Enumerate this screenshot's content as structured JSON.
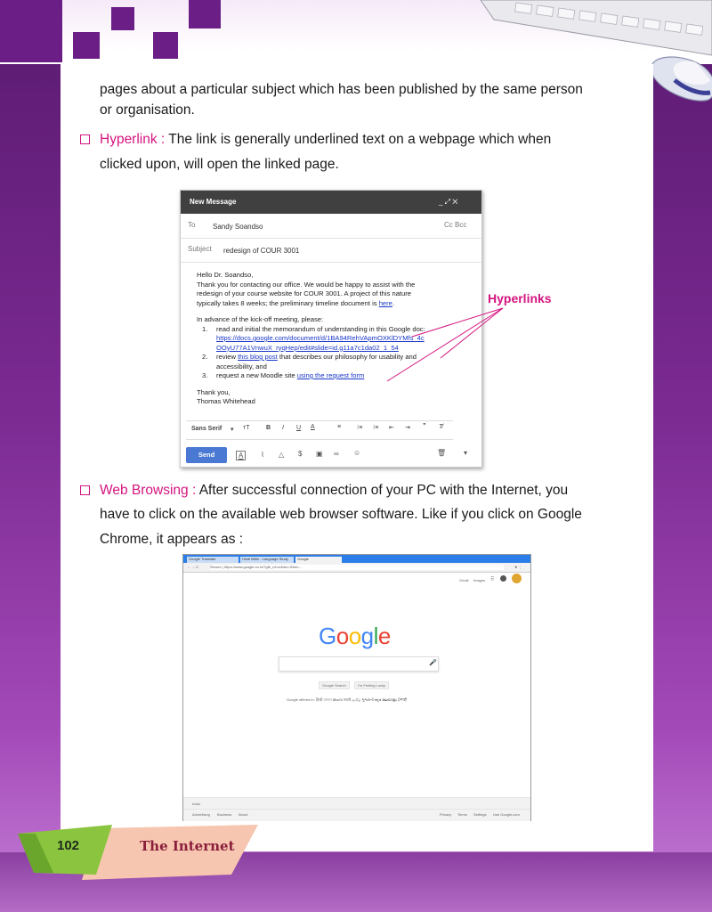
{
  "page_text": {
    "line1": "pages about a particular subject which has been published by the same person",
    "line2": "or organisation.",
    "hyperlink": {
      "term": "Hyperlink :",
      "line1": " The link is generally underlined text on a webpage which when",
      "line2": "clicked upon, will open the linked page."
    },
    "web_browsing": {
      "term": "Web Browsing :",
      "line1": " After successful connection of your PC with the Internet, you",
      "line2": "have to click on the available web browser software. Like if you click on Google",
      "line3": "Chrome, it appears as :"
    },
    "hyperlinks_callout": "Hyperlinks"
  },
  "email": {
    "window_title": "New Message",
    "window_controls": "_ ⤢ ✕",
    "to_label": "To",
    "to_value": "Sandy Soandso",
    "cc_bcc": "Cc Bcc",
    "subject_label": "Subject",
    "subject_value": "redesign of COUR 3001",
    "greeting": "Hello Dr. Soandso,",
    "p1a": "Thank you for contacting our office. We would be happy to assist with the",
    "p1b": "redesign of your course website for COUR 3001. A project of this nature",
    "p1c": "typically takes 8 weeks; the preliminary timeline document is ",
    "p1_link": "here",
    "p1_end": ".",
    "p2": "In advance of the kick-off meeting, please:",
    "item1_num": "1.",
    "item1_text": "read and initial the memorandum of understanding in this Google doc:",
    "item1_link1": "https://docs.google.com/document/d/1BA94RehVApmOXKlDYMfs_4c",
    "item1_link2": "OOyU77A1VnwuX_ryqHep/edit#slide=id.g11a7c1da02_1_54",
    "item2_num": "2.",
    "item2_pre": "review ",
    "item2_link": "this blog post",
    "item2_post": " that describes our philosophy for usability and",
    "item2_line2": "accessibility, and",
    "item3_num": "3.",
    "item3_pre": "request a new Moodle site ",
    "item3_link": "using the request form",
    "closing1": "Thank you,",
    "closing2": "Thomas Whitehead",
    "font_select": "Sans Serif",
    "send_label": "Send"
  },
  "chrome": {
    "tab1": "Google Translate",
    "tab2": "Hindi Bible - Language Study",
    "tab3": "Google",
    "address": "Secure | https://www.google.co.in/?gfe_rd=cr&dcr=0&ei=...",
    "gmail": "Gmail",
    "images": "Images",
    "logo_letters": [
      "G",
      "o",
      "o",
      "g",
      "l",
      "e"
    ],
    "logo_colors": [
      "#4285F4",
      "#EA4335",
      "#FBBC05",
      "#4285F4",
      "#34A853",
      "#EA4335"
    ],
    "search_button": "Google Search",
    "lucky_button": "I'm Feeling Lucky",
    "offered_in": "Google offered in: हिन्दी বাংলা తెలుగు मराठी தமிழ் ગુજરાતી ಕನ್ನಡ മലയാളം ਪੰਜਾਬੀ",
    "footer_country": "India",
    "footer_left": [
      "Advertising",
      "Business",
      "About"
    ],
    "footer_right": [
      "Privacy",
      "Terms",
      "Settings",
      "Use Google.com"
    ]
  },
  "footer": {
    "page_number": "102",
    "chapter_title": "The Internet"
  },
  "colors": {
    "accent_magenta": "#d4147f",
    "purple": "#6b1f86",
    "link_blue": "#1a37c7"
  }
}
